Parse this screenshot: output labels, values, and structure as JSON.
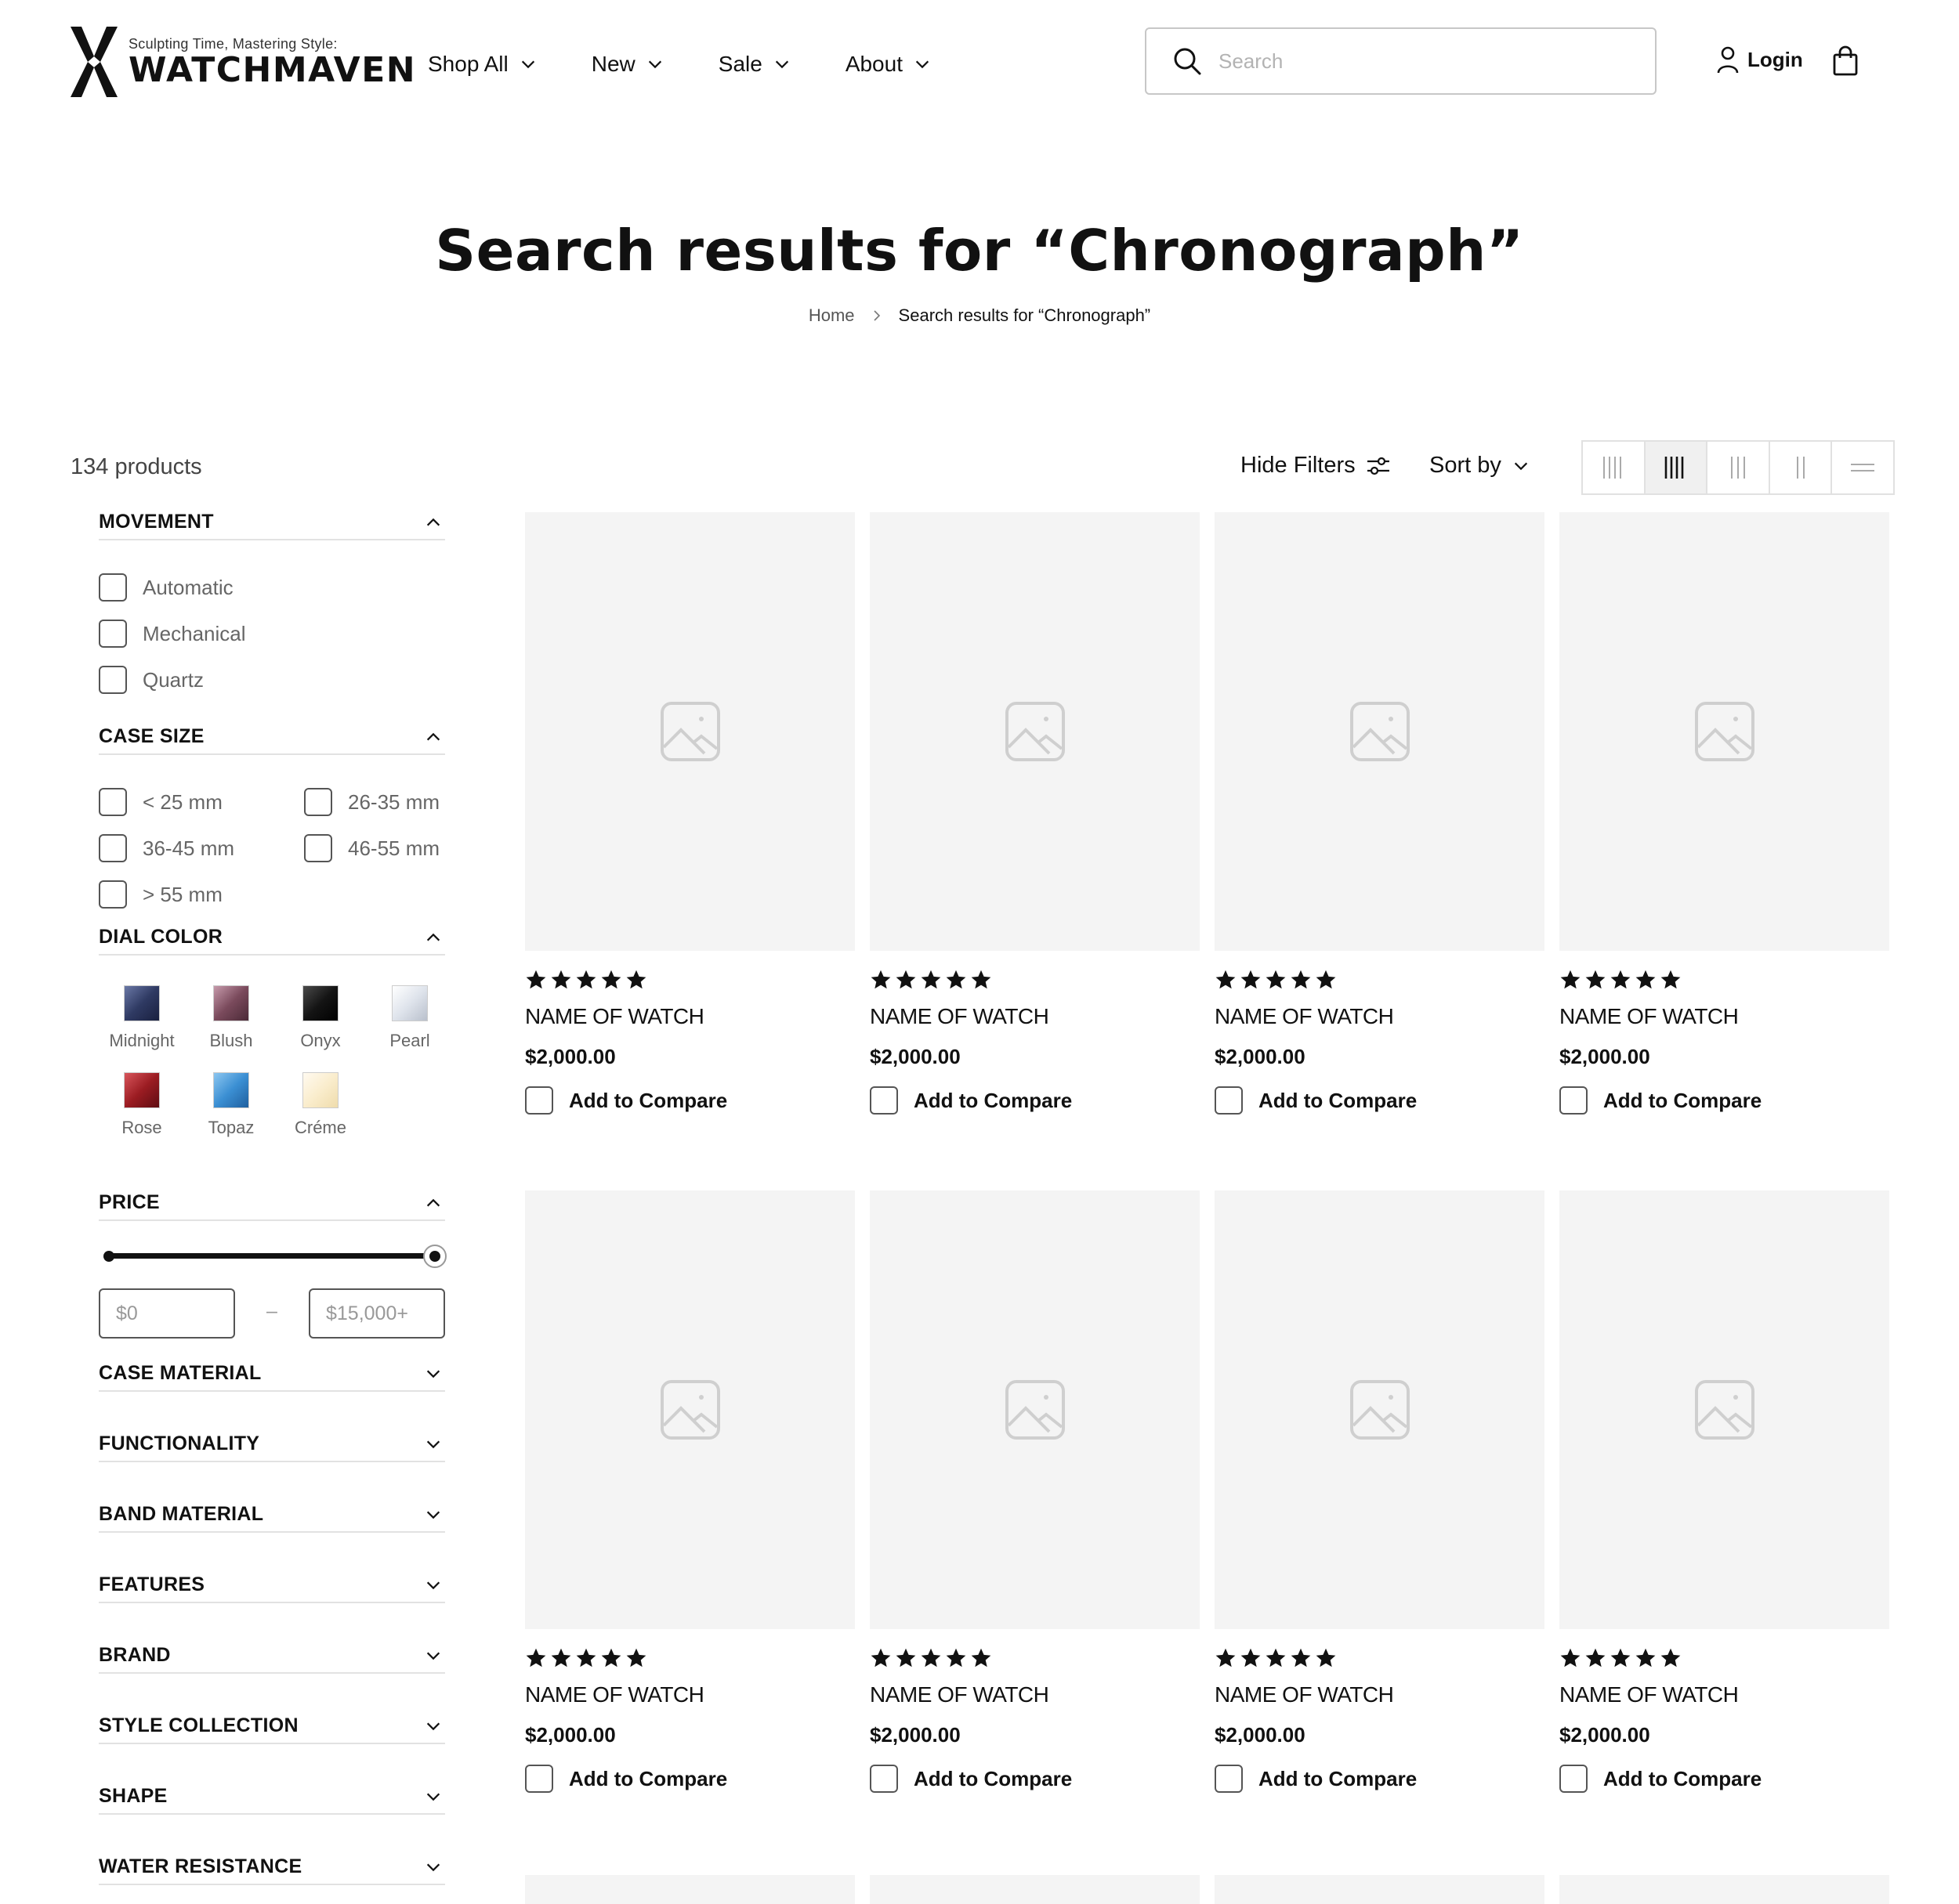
{
  "header": {
    "logo": {
      "tagline": "Sculpting Time, Mastering Style:",
      "name": "WATCHMAVEN"
    },
    "nav": [
      {
        "label": "Shop All"
      },
      {
        "label": "New"
      },
      {
        "label": "Sale"
      },
      {
        "label": "About"
      }
    ],
    "search": {
      "placeholder": "Search",
      "value": ""
    },
    "login_label": "Login"
  },
  "page": {
    "title": "Search results for “Chronograph”",
    "breadcrumb": {
      "home": "Home",
      "current": "Search results for “Chronograph”"
    }
  },
  "toolbar": {
    "product_count": "134 products",
    "hide_filters_label": "Hide Filters",
    "sort_by_label": "Sort by",
    "view_modes": [
      "5-columns",
      "4-columns",
      "3-columns",
      "2-columns",
      "list"
    ],
    "active_view": "4-columns"
  },
  "filters": {
    "movement": {
      "title": "MOVEMENT",
      "expanded": true,
      "options": [
        "Automatic",
        "Mechanical",
        "Quartz"
      ]
    },
    "case_size": {
      "title": "CASE SIZE",
      "expanded": true,
      "options": [
        "< 25 mm",
        "26-35 mm",
        "36-45 mm",
        "46-55 mm",
        "> 55 mm"
      ]
    },
    "dial_color": {
      "title": "DIAL COLOR",
      "expanded": true,
      "swatches": [
        {
          "name": "Midnight",
          "color": "#2f3a63"
        },
        {
          "name": "Blush",
          "color": "#7a4a5c"
        },
        {
          "name": "Onyx",
          "color": "#141414"
        },
        {
          "name": "Pearl",
          "color": "#dfe4ec"
        },
        {
          "name": "Rose",
          "color": "#9b1c22"
        },
        {
          "name": "Topaz",
          "color": "#3b8fd3"
        },
        {
          "name": "Créme",
          "color": "#faedcd"
        }
      ]
    },
    "price": {
      "title": "PRICE",
      "expanded": true,
      "min_placeholder": "$0",
      "max_placeholder": "$15,000+",
      "dash": "–",
      "range_fraction": [
        0,
        1
      ]
    },
    "collapsed": [
      {
        "title": "CASE MATERIAL"
      },
      {
        "title": "FUNCTIONALITY"
      },
      {
        "title": "BAND MATERIAL"
      },
      {
        "title": "FEATURES"
      },
      {
        "title": "BRAND"
      },
      {
        "title": "STYLE COLLECTION"
      },
      {
        "title": "SHAPE"
      },
      {
        "title": "WATER RESISTANCE"
      }
    ]
  },
  "products": [
    {
      "name": "NAME OF WATCH",
      "price": "$2,000.00",
      "rating": 5,
      "compare_label": "Add to Compare"
    },
    {
      "name": "NAME OF WATCH",
      "price": "$2,000.00",
      "rating": 5,
      "compare_label": "Add to Compare"
    },
    {
      "name": "NAME OF WATCH",
      "price": "$2,000.00",
      "rating": 5,
      "compare_label": "Add to Compare"
    },
    {
      "name": "NAME OF WATCH",
      "price": "$2,000.00",
      "rating": 5,
      "compare_label": "Add to Compare"
    },
    {
      "name": "NAME OF WATCH",
      "price": "$2,000.00",
      "rating": 5,
      "compare_label": "Add to Compare"
    },
    {
      "name": "NAME OF WATCH",
      "price": "$2,000.00",
      "rating": 5,
      "compare_label": "Add to Compare"
    },
    {
      "name": "NAME OF WATCH",
      "price": "$2,000.00",
      "rating": 5,
      "compare_label": "Add to Compare"
    },
    {
      "name": "NAME OF WATCH",
      "price": "$2,000.00",
      "rating": 5,
      "compare_label": "Add to Compare"
    }
  ],
  "colors": {
    "text": "#111111",
    "muted": "#666666",
    "image_placeholder": "#f4f4f4",
    "border": "#e2e2e2"
  }
}
